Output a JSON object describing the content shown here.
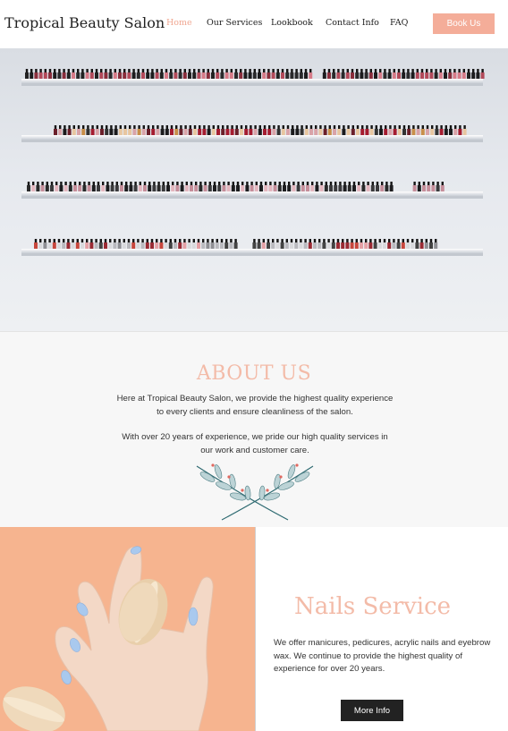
{
  "header": {
    "logo": "Tropical Beauty Salon",
    "nav": [
      "Home",
      "Our Services",
      "Lookbook",
      "Contact Info",
      "FAQ"
    ],
    "active": "Home",
    "book_label": "Book Us"
  },
  "about": {
    "title": "ABOUT US",
    "p1": "Here at Tropical Beauty Salon, we provide the highest quality experience to every clients and ensure cleanliness of the salon.",
    "p2": "With over 20 years of experience, we pride our high quality services in our work and customer care."
  },
  "nails": {
    "title": "Nails Service",
    "description": "We offer manicures, pedicures, acrylic nails and eyebrow wax. We continue to provide the highest quality of experience for over 20 years.",
    "button": "More Info"
  },
  "colors": {
    "accent": "#f3bba8",
    "button_peach": "#f4ad99",
    "dark_button": "#222222"
  }
}
